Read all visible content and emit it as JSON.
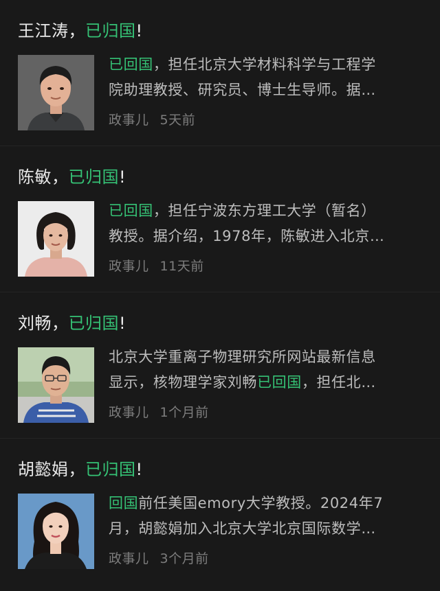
{
  "articles": [
    {
      "name_prefix": "王江涛，",
      "name_highlight": "已归国",
      "name_suffix": "!",
      "snippet_highlight": "已回国",
      "snippet_line1_rest": "，担任北京大学材料科学与工程学",
      "snippet_line2": "院助理教授、研究员、博士生导师。据…",
      "source": "政事儿",
      "time": "5天前"
    },
    {
      "name_prefix": "陈敏，",
      "name_highlight": "已归国",
      "name_suffix": "!",
      "snippet_highlight": "已回国",
      "snippet_line1_rest": "，担任宁波东方理工大学（暂名）",
      "snippet_line2": "教授。据介绍，1978年，陈敏进入北京…",
      "source": "政事儿",
      "time": "11天前"
    },
    {
      "name_prefix": "刘畅，",
      "name_highlight": "已归国",
      "name_suffix": "!",
      "snippet_line1": "北京大学重离子物理研究所网站最新信息",
      "snippet_line2_pre": "显示，核物理学家刘畅",
      "snippet_highlight": "已回国",
      "snippet_line2_rest": "，担任北…",
      "source": "政事儿",
      "time": "1个月前"
    },
    {
      "name_prefix": "胡懿娟，",
      "name_highlight": "已归国",
      "name_suffix": "!",
      "snippet_highlight": "回国",
      "snippet_line1_rest": "前任美国emory大学教授。2024年7",
      "snippet_line2": "月，胡懿娟加入北京大学北京国际数学…",
      "source": "政事儿",
      "time": "3个月前"
    }
  ]
}
